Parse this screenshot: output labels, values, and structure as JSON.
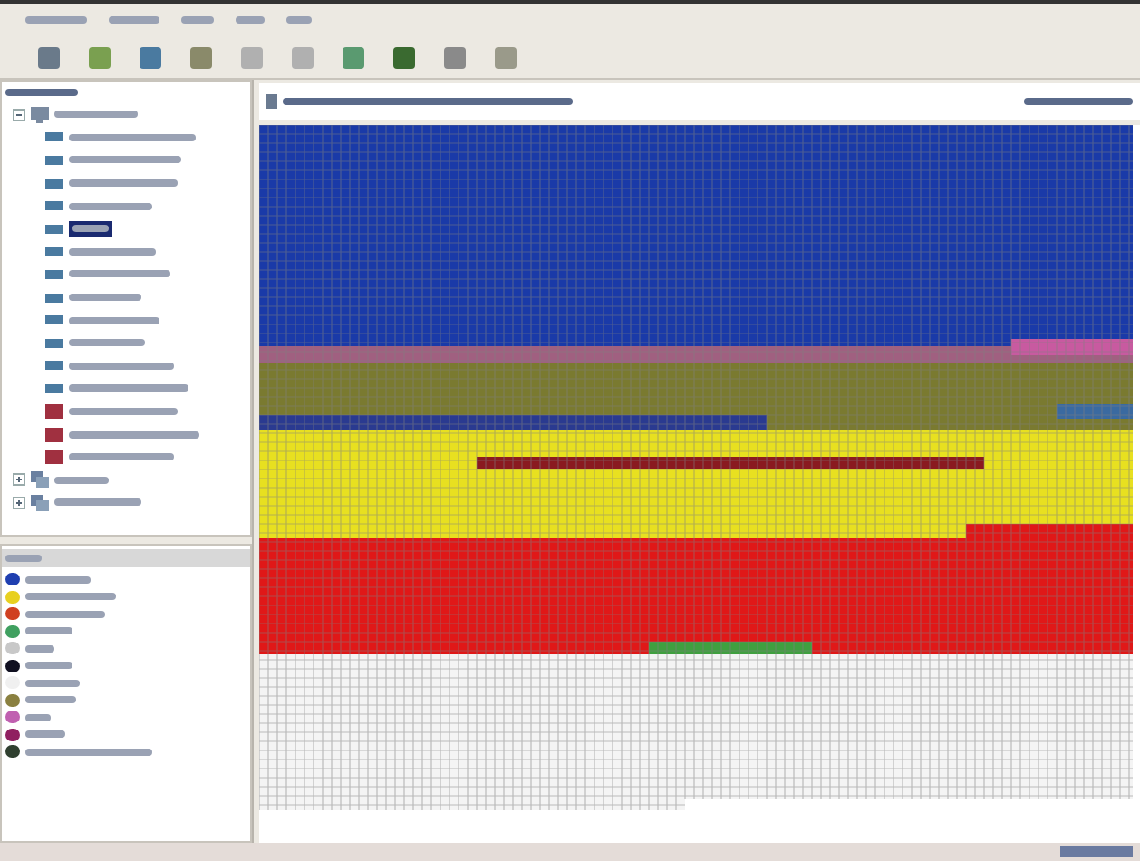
{
  "tree": {
    "items": [
      {
        "kind": "computer",
        "selected": false,
        "expanded": true,
        "children": [
          {
            "kind": "drive",
            "selected": false
          },
          {
            "kind": "drive",
            "selected": false
          },
          {
            "kind": "drive",
            "selected": false
          },
          {
            "kind": "drive",
            "selected": false
          },
          {
            "kind": "drive",
            "selected": true
          },
          {
            "kind": "drive",
            "selected": false
          },
          {
            "kind": "drive",
            "selected": false
          },
          {
            "kind": "drive",
            "selected": false
          },
          {
            "kind": "drive",
            "selected": false
          },
          {
            "kind": "drive",
            "selected": false
          },
          {
            "kind": "drive",
            "selected": false
          },
          {
            "kind": "drive",
            "selected": false
          },
          {
            "kind": "folder",
            "selected": false
          },
          {
            "kind": "folder",
            "selected": false
          },
          {
            "kind": "folder",
            "selected": false
          }
        ]
      },
      {
        "kind": "network",
        "selected": false,
        "expanded": false
      },
      {
        "kind": "network",
        "selected": false,
        "expanded": false
      }
    ]
  },
  "legend": {
    "items": [
      {
        "color": "#1f3fb0"
      },
      {
        "color": "#e8d020"
      },
      {
        "color": "#d04020"
      },
      {
        "color": "#40a060"
      },
      {
        "color": "#c8c8c8"
      },
      {
        "color": "#101020"
      },
      {
        "color": "#f0f0f0"
      },
      {
        "color": "#8a8040"
      },
      {
        "color": "#c060b0"
      },
      {
        "color": "#902060"
      },
      {
        "color": "#304030"
      }
    ]
  }
}
